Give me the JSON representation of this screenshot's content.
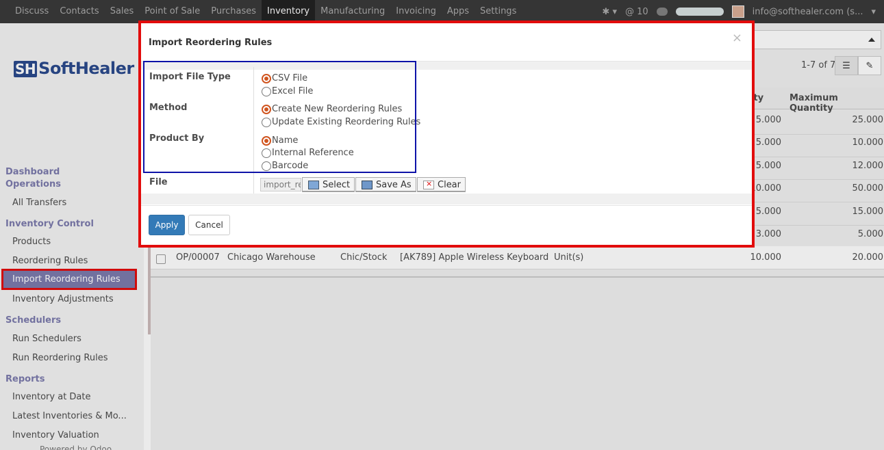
{
  "topnav": {
    "items": [
      "Discuss",
      "Contacts",
      "Sales",
      "Point of Sale",
      "Purchases",
      "Inventory",
      "Manufacturing",
      "Invoicing",
      "Apps",
      "Settings"
    ],
    "active": "Inventory"
  },
  "topright": {
    "mention_count": "@ 10",
    "progress": 0.3,
    "user_email": "info@softhealer.com (s..."
  },
  "sidebar": {
    "logo_mark": "SH",
    "logo_text": "SoftHealer",
    "headings": [
      "Dashboard Operations",
      "Inventory Control",
      "Schedulers",
      "Reports"
    ],
    "dashboard_line1": "Dashboard",
    "dashboard_line2": "Operations",
    "inventory_control": "Inventory Control",
    "schedulers": "Schedulers",
    "reports": "Reports",
    "items": {
      "all_transfers": "All Transfers",
      "products": "Products",
      "reordering_rules": "Reordering Rules",
      "import_reordering_rules": "Import Reordering Rules",
      "inventory_adjustments": "Inventory Adjustments",
      "run_schedulers": "Run Schedulers",
      "run_reordering_rules": "Run Reordering Rules",
      "inventory_at_date": "Inventory at Date",
      "latest_inventories": "Latest Inventories & Mo...",
      "inventory_valuation": "Inventory Valuation"
    },
    "powered": "Powered by Odoo"
  },
  "main": {
    "pager": "1-7 of 7",
    "col_min_partial": "ity",
    "col_max": "Maximum Quantity",
    "rows_min": [
      "5.000",
      "5.000",
      "5.000",
      "10.000",
      "5.000",
      "3.000"
    ],
    "rows_max": [
      "25.000",
      "10.000",
      "12.000",
      "50.000",
      "15.000",
      "5.000"
    ],
    "last_row": {
      "name": "OP/00007",
      "warehouse": "Chicago Warehouse",
      "location": "Chic/Stock",
      "product": "[AK789] Apple Wireless Keyboard",
      "uom": "Unit(s)",
      "min": "10.000",
      "max": "20.000"
    }
  },
  "modal": {
    "title": "Import Reordering Rules",
    "close": "×",
    "labels": {
      "file_type": "Import File Type",
      "method": "Method",
      "product_by": "Product By",
      "file": "File"
    },
    "file_type_options": [
      "CSV File",
      "Excel File"
    ],
    "file_type_selected": "CSV File",
    "method_options": [
      "Create New Reordering Rules",
      "Update Existing Reordering Rules"
    ],
    "method_selected": "Create New Reordering Rules",
    "product_by_options": [
      "Name",
      "Internal Reference",
      "Barcode"
    ],
    "product_by_selected": "Name",
    "file_value": "import_re",
    "buttons": {
      "select": "Select",
      "save_as": "Save As",
      "clear": "Clear",
      "apply": "Apply",
      "cancel": "Cancel"
    }
  }
}
